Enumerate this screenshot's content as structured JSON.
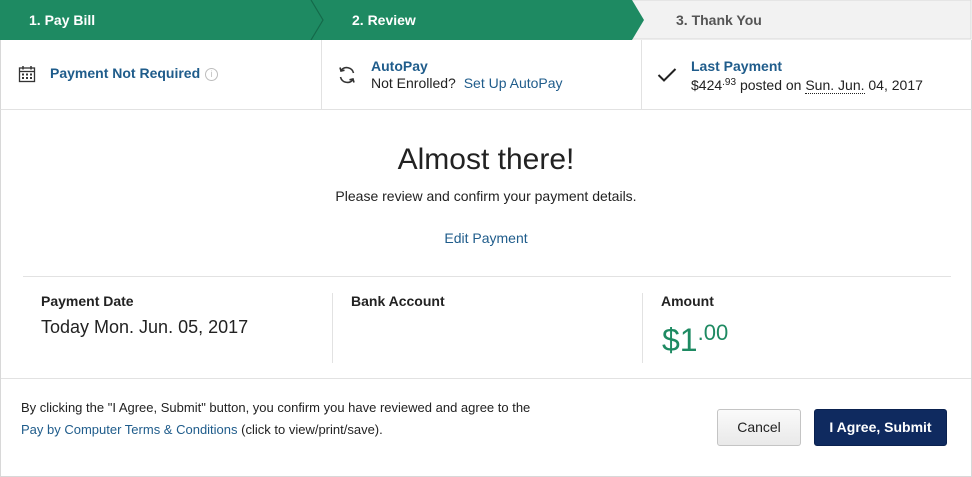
{
  "stepper": {
    "steps": [
      {
        "label": "1.  Pay Bill",
        "state": "complete"
      },
      {
        "label": "2.  Review",
        "state": "current"
      },
      {
        "label": "3.  Thank You",
        "state": "upcoming"
      }
    ],
    "colors": {
      "active": "#1e8a62",
      "inactive": "#f2f2f2"
    }
  },
  "info": {
    "payment_status": {
      "label": "Payment Not Required",
      "help_glyph": "i",
      "icon": "calendar-icon"
    },
    "autopay": {
      "title": "AutoPay",
      "status_text": "Not Enrolled?",
      "setup_link": "Set Up AutoPay",
      "icon": "refresh-icon"
    },
    "last_payment": {
      "title": "Last Payment",
      "amount_dollars": "$424",
      "amount_cents": ".93",
      "posted_text": "posted on",
      "date_abbrev": "Sun. Jun.",
      "date_rest": "04, 2017",
      "icon": "checkmark-icon"
    }
  },
  "review": {
    "heading": "Almost there!",
    "subheading": "Please review and confirm your payment details.",
    "edit_link": "Edit Payment"
  },
  "details": {
    "payment_date": {
      "label": "Payment Date",
      "value": "Today Mon. Jun. 05, 2017"
    },
    "bank_account": {
      "label": "Bank Account",
      "value": ""
    },
    "amount": {
      "label": "Amount",
      "dollars": "$1",
      "cents": ".00",
      "color": "#1e8a62"
    }
  },
  "footer": {
    "terms_line1": "By clicking the \"I Agree, Submit\" button, you confirm you have reviewed and agree to the",
    "terms_link": "Pay by Computer Terms & Conditions",
    "terms_suffix": "(click to view/print/save).",
    "cancel_label": "Cancel",
    "submit_label": "I Agree, Submit"
  }
}
